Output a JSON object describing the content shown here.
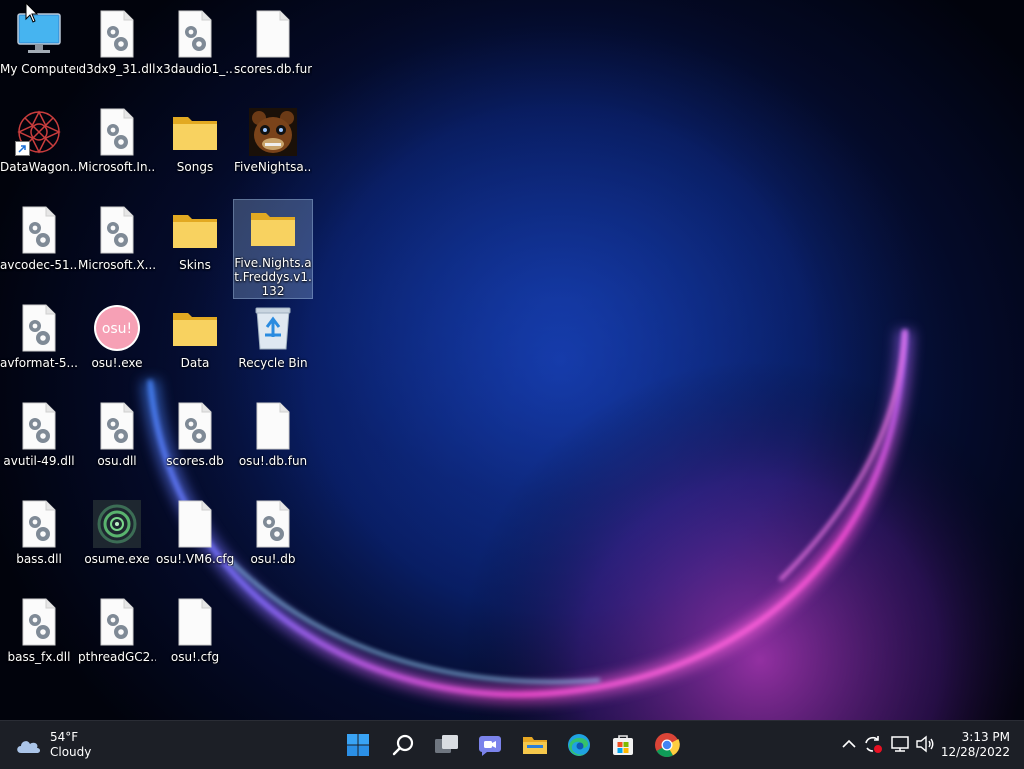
{
  "desktop": {
    "icons": [
      {
        "label": "My Computer",
        "type": "computer"
      },
      {
        "label": "d3dx9_31.dll",
        "type": "dll"
      },
      {
        "label": "x3daudio1_...",
        "type": "dll"
      },
      {
        "label": "scores.db.fun",
        "type": "file"
      },
      {
        "label": "DataWagon...",
        "type": "datawagon"
      },
      {
        "label": "Microsoft.In...",
        "type": "dll"
      },
      {
        "label": "Songs",
        "type": "folder"
      },
      {
        "label": "FiveNightsa...",
        "type": "fnaf"
      },
      {
        "label": "avcodec-51....",
        "type": "dll"
      },
      {
        "label": "Microsoft.X...",
        "type": "dll"
      },
      {
        "label": "Skins",
        "type": "folder"
      },
      {
        "label": "Five.Nights.at.Freddys.v1.132",
        "type": "folder"
      },
      {
        "label": "avformat-5...",
        "type": "dll"
      },
      {
        "label": "osu!.exe",
        "type": "osu"
      },
      {
        "label": "Data",
        "type": "folder"
      },
      {
        "label": "Recycle Bin",
        "type": "recycle"
      },
      {
        "label": "avutil-49.dll",
        "type": "dll"
      },
      {
        "label": "osu.dll",
        "type": "dll"
      },
      {
        "label": "scores.db",
        "type": "dll"
      },
      {
        "label": "osu!.db.fun",
        "type": "file"
      },
      {
        "label": "bass.dll",
        "type": "dll"
      },
      {
        "label": "osume.exe",
        "type": "osume"
      },
      {
        "label": "osu!.VM6.cfg",
        "type": "file"
      },
      {
        "label": "osu!.db",
        "type": "dll"
      },
      {
        "label": "bass_fx.dll",
        "type": "dll"
      },
      {
        "label": "pthreadGC2...",
        "type": "dll"
      },
      {
        "label": "osu!.cfg",
        "type": "file"
      }
    ]
  },
  "taskbar": {
    "weather": {
      "temp": "54°F",
      "condition": "Cloudy",
      "icon": "cloud-icon"
    },
    "apps": [
      {
        "name": "start-button",
        "icon": "windows-logo-icon"
      },
      {
        "name": "search-button",
        "icon": "search-icon"
      },
      {
        "name": "task-view-button",
        "icon": "task-view-icon"
      },
      {
        "name": "chat-button",
        "icon": "chat-icon"
      },
      {
        "name": "file-explorer-button",
        "icon": "folder-icon"
      },
      {
        "name": "edge-button",
        "icon": "edge-icon"
      },
      {
        "name": "store-button",
        "icon": "store-icon"
      },
      {
        "name": "chrome-button",
        "icon": "chrome-icon"
      }
    ],
    "clock": {
      "time": "3:13 PM",
      "date": "12/28/2022"
    }
  },
  "colors": {
    "accent": "#0078d4",
    "taskbar": "#1c1f26",
    "folder": "#f4c542"
  }
}
